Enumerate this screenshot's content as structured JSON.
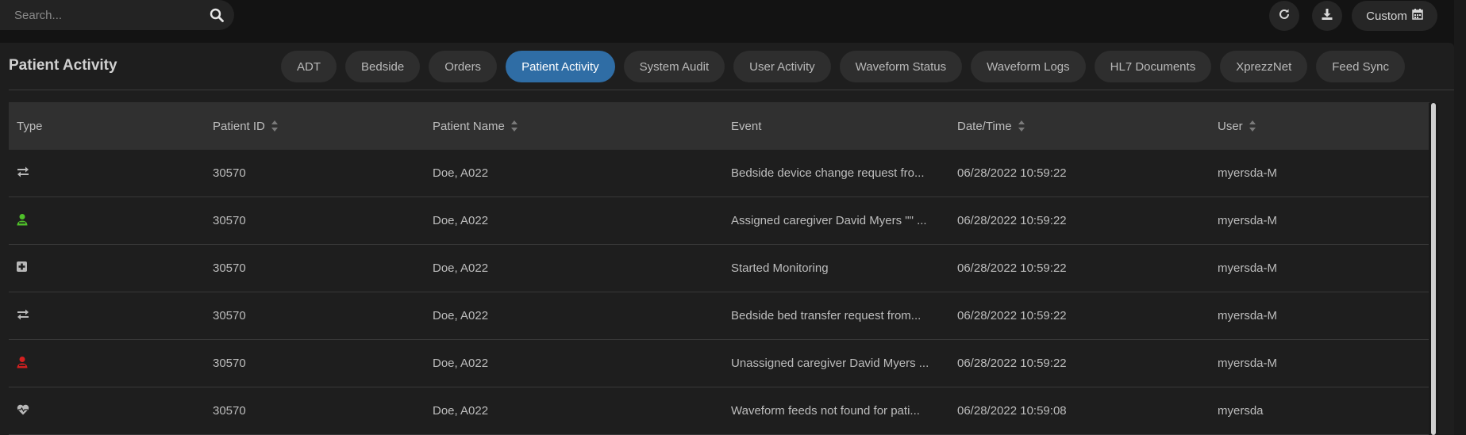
{
  "search": {
    "placeholder": "Search...",
    "icon": "search-icon"
  },
  "toolbar": {
    "refresh_icon": "refresh-icon",
    "download_icon": "download-icon",
    "custom_label": "Custom",
    "custom_icon": "calendar-icon"
  },
  "panel": {
    "title": "Patient Activity"
  },
  "tabs": [
    {
      "label": "ADT",
      "active": false
    },
    {
      "label": "Bedside",
      "active": false
    },
    {
      "label": "Orders",
      "active": false
    },
    {
      "label": "Patient Activity",
      "active": true
    },
    {
      "label": "System Audit",
      "active": false
    },
    {
      "label": "User Activity",
      "active": false
    },
    {
      "label": "Waveform Status",
      "active": false
    },
    {
      "label": "Waveform Logs",
      "active": false
    },
    {
      "label": "HL7 Documents",
      "active": false
    },
    {
      "label": "XprezzNet",
      "active": false
    },
    {
      "label": "Feed Sync",
      "active": false
    }
  ],
  "table": {
    "columns": [
      "Type",
      "Patient ID",
      "Patient Name",
      "Event",
      "Date/Time",
      "User"
    ],
    "rows": [
      {
        "type_icon": "transfer-arrows-icon",
        "icon_color": "#b8b8b8",
        "patient_id": "30570",
        "patient_name": "Doe, A022",
        "event": "Bedside device change request fro...",
        "datetime": "06/28/2022 10:59:22",
        "user": "myersda-M"
      },
      {
        "type_icon": "caregiver-assigned-icon",
        "icon_color": "#4fc02a",
        "patient_id": "30570",
        "patient_name": "Doe, A022",
        "event": "Assigned caregiver David Myers \"\" ...",
        "datetime": "06/28/2022 10:59:22",
        "user": "myersda-M"
      },
      {
        "type_icon": "monitoring-plus-icon",
        "icon_color": "#b8b8b8",
        "patient_id": "30570",
        "patient_name": "Doe, A022",
        "event": "Started Monitoring",
        "datetime": "06/28/2022 10:59:22",
        "user": "myersda-M"
      },
      {
        "type_icon": "transfer-arrows-icon",
        "icon_color": "#b8b8b8",
        "patient_id": "30570",
        "patient_name": "Doe, A022",
        "event": "Bedside bed transfer request from...",
        "datetime": "06/28/2022 10:59:22",
        "user": "myersda-M"
      },
      {
        "type_icon": "caregiver-unassigned-icon",
        "icon_color": "#d42020",
        "patient_id": "30570",
        "patient_name": "Doe, A022",
        "event": "Unassigned caregiver David Myers ...",
        "datetime": "06/28/2022 10:59:22",
        "user": "myersda-M"
      },
      {
        "type_icon": "heart-pulse-icon",
        "icon_color": "#b8b8b8",
        "patient_id": "30570",
        "patient_name": "Doe, A022",
        "event": "Waveform feeds not found for pati...",
        "datetime": "06/28/2022 10:59:08",
        "user": "myersda"
      }
    ]
  }
}
